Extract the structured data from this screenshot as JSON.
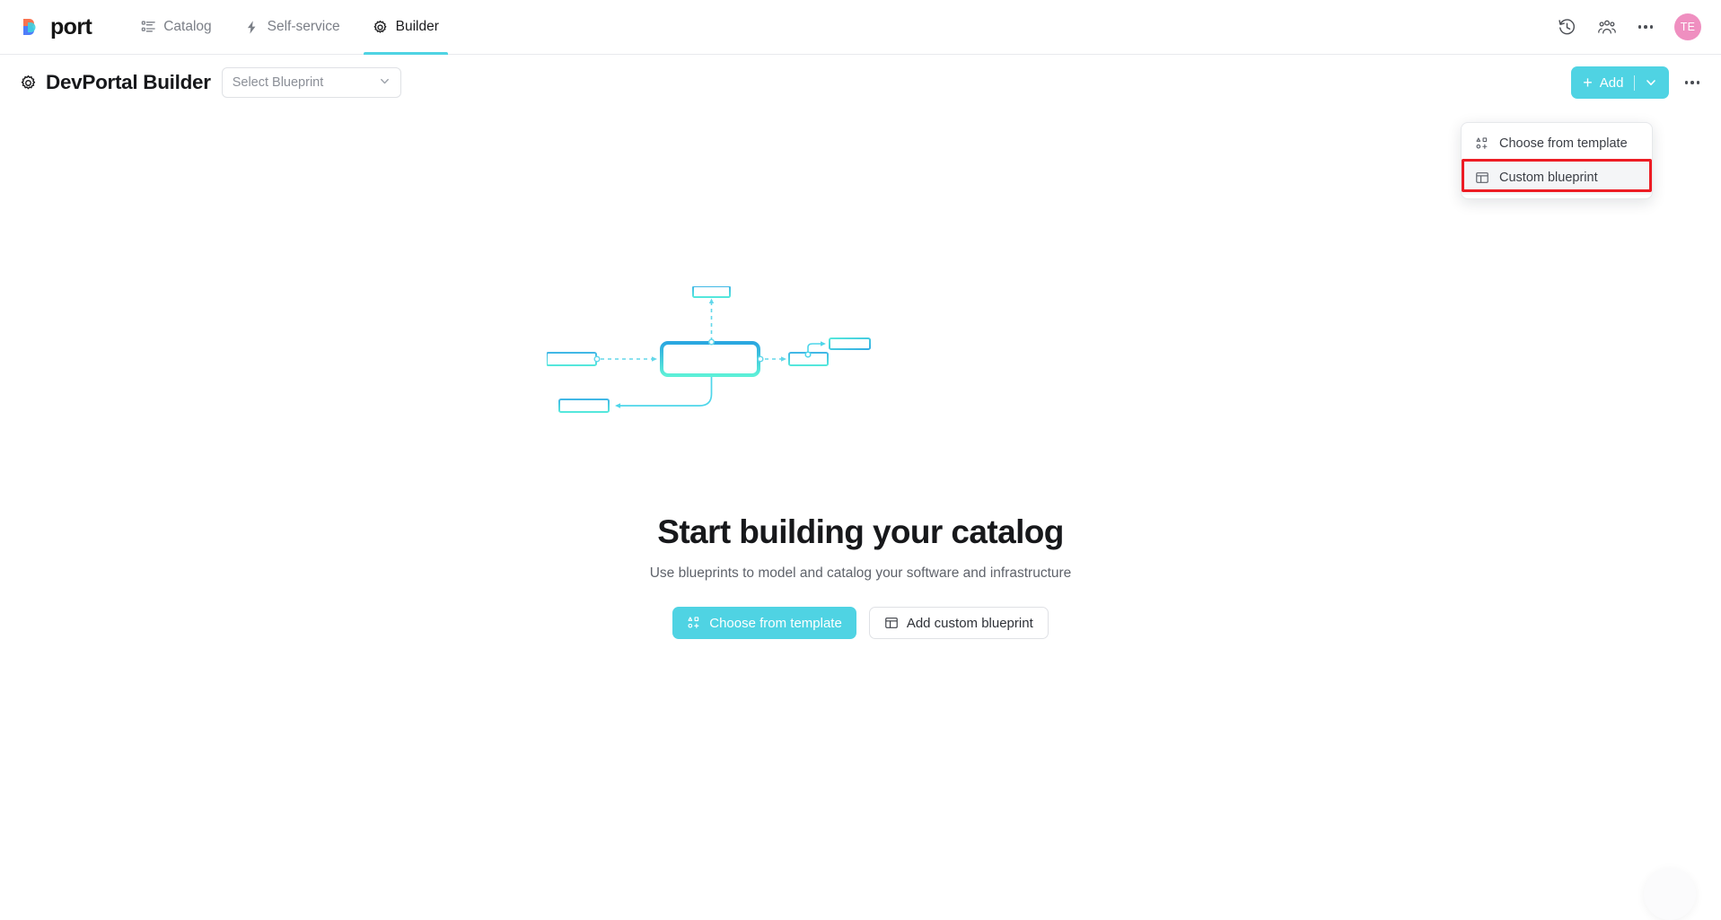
{
  "brand": {
    "logo_text": "port",
    "logo_colors": [
      "#f9734f",
      "#4f7df9",
      "#3ed0e0"
    ],
    "accent": "#4fd3e3"
  },
  "topnav": {
    "items": [
      {
        "label": "Catalog",
        "icon": "list-icon",
        "active": false
      },
      {
        "label": "Self-service",
        "icon": "lightning-icon",
        "active": false
      },
      {
        "label": "Builder",
        "icon": "gear-icon",
        "active": true
      }
    ],
    "right": {
      "history_icon": "history-clock-icon",
      "users_icon": "users-group-icon",
      "more_icon": "more-horizontal-icon",
      "avatar_initials": "TE",
      "avatar_color": "#ef8fc0"
    }
  },
  "page_header": {
    "gear_icon": "gear-icon",
    "title": "DevPortal Builder",
    "blueprint_select": {
      "placeholder": "Select Blueprint",
      "value": "Select Blueprint",
      "chevron_icon": "chevron-down-icon"
    },
    "add_button": {
      "label": "Add",
      "plus_icon": "plus-icon",
      "chevron_icon": "chevron-down-icon"
    },
    "more_icon": "more-horizontal-icon"
  },
  "add_dropdown": {
    "open": true,
    "items": [
      {
        "label": "Choose from template",
        "icon": "template-shapes-icon",
        "highlighted": false
      },
      {
        "label": "Custom blueprint",
        "icon": "layout-panel-icon",
        "highlighted": true
      }
    ],
    "highlight_color": "#ed1c24"
  },
  "empty_state": {
    "illustration_name": "blueprint-graph-illustration",
    "headline": "Start building your catalog",
    "subtitle": "Use blueprints to model and catalog your software and infrastructure",
    "buttons": [
      {
        "label": "Choose from template",
        "icon": "template-shapes-icon",
        "style": "primary"
      },
      {
        "label": "Add custom blueprint",
        "icon": "layout-panel-icon",
        "style": "secondary"
      }
    ]
  },
  "chat_widget": {
    "name": "support-chat-bubble"
  }
}
